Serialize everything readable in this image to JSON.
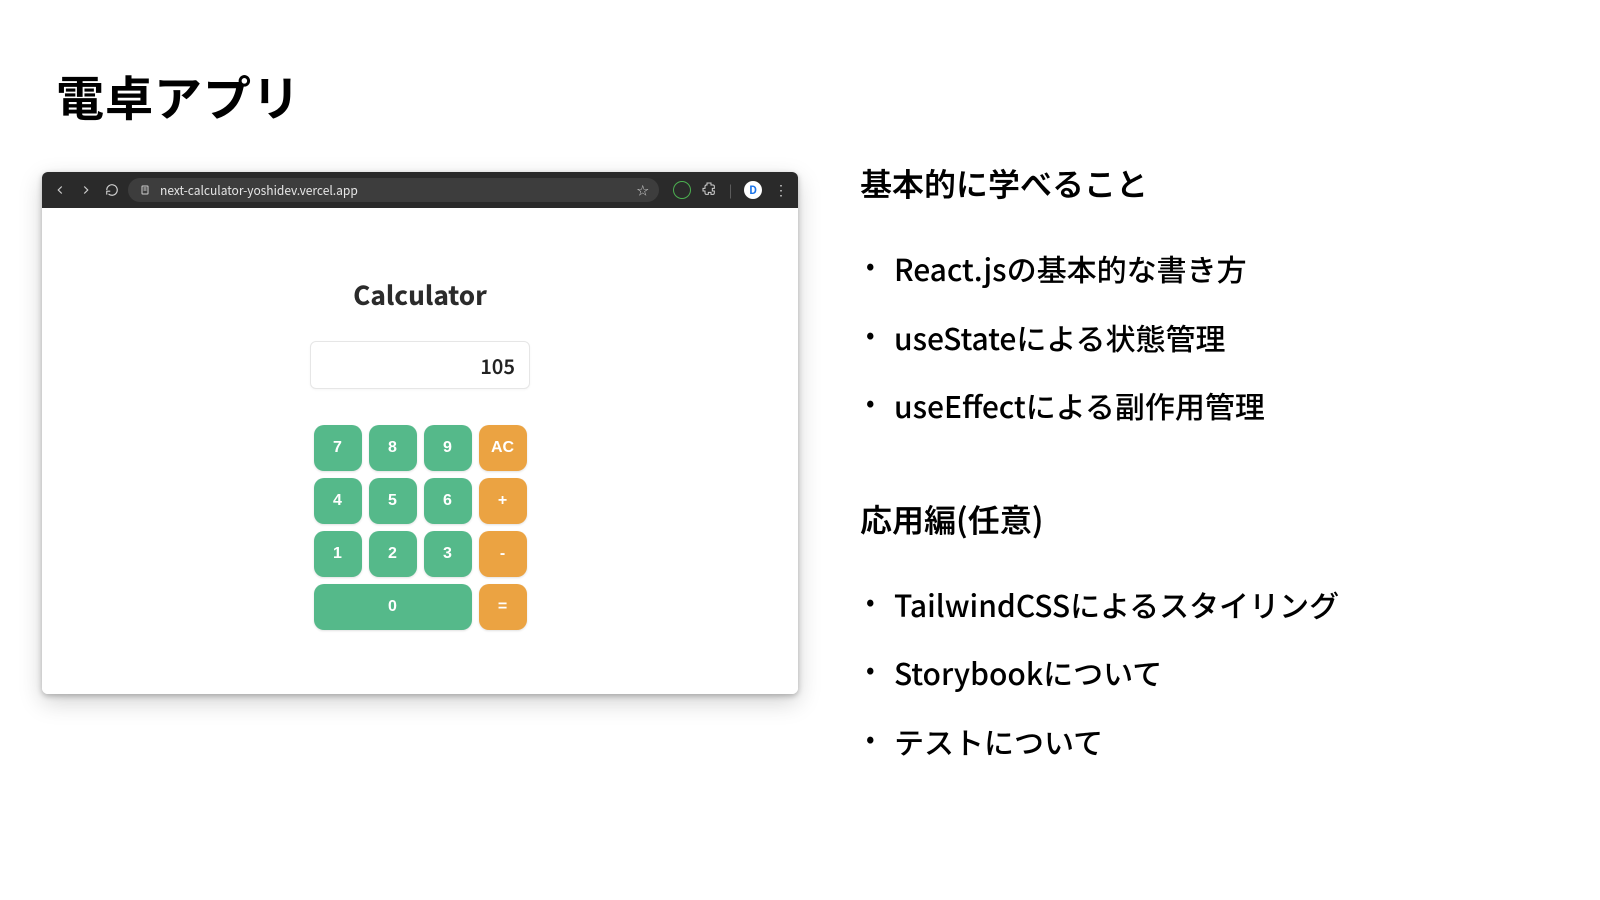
{
  "title": "電卓アプリ",
  "browser": {
    "url": "next-calculator-yoshidev.vercel.app"
  },
  "calculator": {
    "heading": "Calculator",
    "display": "105",
    "keys": {
      "k7": "7",
      "k8": "8",
      "k9": "9",
      "ac": "AC",
      "k4": "4",
      "k5": "5",
      "k6": "6",
      "plus": "+",
      "k1": "1",
      "k2": "2",
      "k3": "3",
      "minus": "-",
      "k0": "0",
      "eq": "="
    }
  },
  "right": {
    "section1_heading": "基本的に学べること",
    "section1_items": [
      "React.jsの基本的な書き方",
      "useStateによる状態管理",
      "useEffectによる副作用管理"
    ],
    "section2_heading": "応用編(任意)",
    "section2_items": [
      "TailwindCSSによるスタイリング",
      "Storybookについて",
      "テストについて"
    ]
  }
}
